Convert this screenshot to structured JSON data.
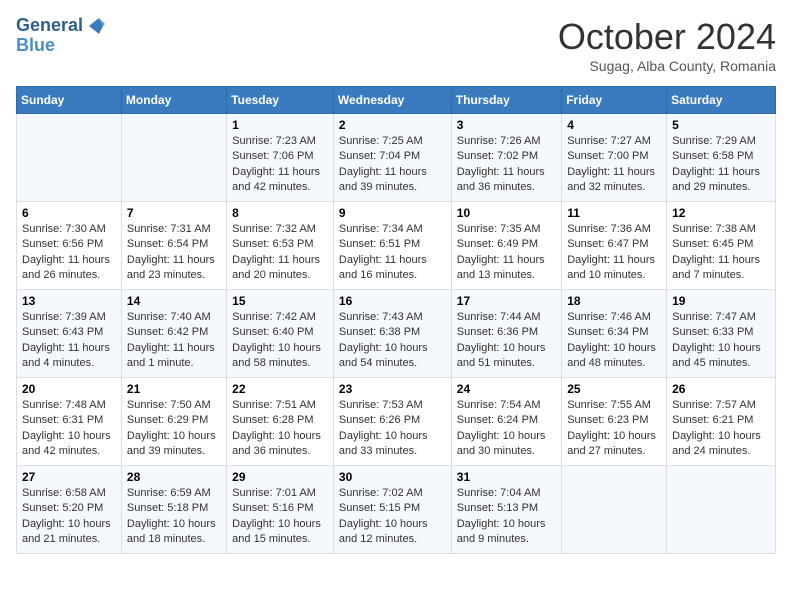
{
  "logo": {
    "line1": "General",
    "line2": "Blue"
  },
  "header": {
    "month": "October 2024",
    "location": "Sugag, Alba County, Romania"
  },
  "weekdays": [
    "Sunday",
    "Monday",
    "Tuesday",
    "Wednesday",
    "Thursday",
    "Friday",
    "Saturday"
  ],
  "weeks": [
    [
      {
        "day": "",
        "info": ""
      },
      {
        "day": "",
        "info": ""
      },
      {
        "day": "1",
        "info": "Sunrise: 7:23 AM\nSunset: 7:06 PM\nDaylight: 11 hours and 42 minutes."
      },
      {
        "day": "2",
        "info": "Sunrise: 7:25 AM\nSunset: 7:04 PM\nDaylight: 11 hours and 39 minutes."
      },
      {
        "day": "3",
        "info": "Sunrise: 7:26 AM\nSunset: 7:02 PM\nDaylight: 11 hours and 36 minutes."
      },
      {
        "day": "4",
        "info": "Sunrise: 7:27 AM\nSunset: 7:00 PM\nDaylight: 11 hours and 32 minutes."
      },
      {
        "day": "5",
        "info": "Sunrise: 7:29 AM\nSunset: 6:58 PM\nDaylight: 11 hours and 29 minutes."
      }
    ],
    [
      {
        "day": "6",
        "info": "Sunrise: 7:30 AM\nSunset: 6:56 PM\nDaylight: 11 hours and 26 minutes."
      },
      {
        "day": "7",
        "info": "Sunrise: 7:31 AM\nSunset: 6:54 PM\nDaylight: 11 hours and 23 minutes."
      },
      {
        "day": "8",
        "info": "Sunrise: 7:32 AM\nSunset: 6:53 PM\nDaylight: 11 hours and 20 minutes."
      },
      {
        "day": "9",
        "info": "Sunrise: 7:34 AM\nSunset: 6:51 PM\nDaylight: 11 hours and 16 minutes."
      },
      {
        "day": "10",
        "info": "Sunrise: 7:35 AM\nSunset: 6:49 PM\nDaylight: 11 hours and 13 minutes."
      },
      {
        "day": "11",
        "info": "Sunrise: 7:36 AM\nSunset: 6:47 PM\nDaylight: 11 hours and 10 minutes."
      },
      {
        "day": "12",
        "info": "Sunrise: 7:38 AM\nSunset: 6:45 PM\nDaylight: 11 hours and 7 minutes."
      }
    ],
    [
      {
        "day": "13",
        "info": "Sunrise: 7:39 AM\nSunset: 6:43 PM\nDaylight: 11 hours and 4 minutes."
      },
      {
        "day": "14",
        "info": "Sunrise: 7:40 AM\nSunset: 6:42 PM\nDaylight: 11 hours and 1 minute."
      },
      {
        "day": "15",
        "info": "Sunrise: 7:42 AM\nSunset: 6:40 PM\nDaylight: 10 hours and 58 minutes."
      },
      {
        "day": "16",
        "info": "Sunrise: 7:43 AM\nSunset: 6:38 PM\nDaylight: 10 hours and 54 minutes."
      },
      {
        "day": "17",
        "info": "Sunrise: 7:44 AM\nSunset: 6:36 PM\nDaylight: 10 hours and 51 minutes."
      },
      {
        "day": "18",
        "info": "Sunrise: 7:46 AM\nSunset: 6:34 PM\nDaylight: 10 hours and 48 minutes."
      },
      {
        "day": "19",
        "info": "Sunrise: 7:47 AM\nSunset: 6:33 PM\nDaylight: 10 hours and 45 minutes."
      }
    ],
    [
      {
        "day": "20",
        "info": "Sunrise: 7:48 AM\nSunset: 6:31 PM\nDaylight: 10 hours and 42 minutes."
      },
      {
        "day": "21",
        "info": "Sunrise: 7:50 AM\nSunset: 6:29 PM\nDaylight: 10 hours and 39 minutes."
      },
      {
        "day": "22",
        "info": "Sunrise: 7:51 AM\nSunset: 6:28 PM\nDaylight: 10 hours and 36 minutes."
      },
      {
        "day": "23",
        "info": "Sunrise: 7:53 AM\nSunset: 6:26 PM\nDaylight: 10 hours and 33 minutes."
      },
      {
        "day": "24",
        "info": "Sunrise: 7:54 AM\nSunset: 6:24 PM\nDaylight: 10 hours and 30 minutes."
      },
      {
        "day": "25",
        "info": "Sunrise: 7:55 AM\nSunset: 6:23 PM\nDaylight: 10 hours and 27 minutes."
      },
      {
        "day": "26",
        "info": "Sunrise: 7:57 AM\nSunset: 6:21 PM\nDaylight: 10 hours and 24 minutes."
      }
    ],
    [
      {
        "day": "27",
        "info": "Sunrise: 6:58 AM\nSunset: 5:20 PM\nDaylight: 10 hours and 21 minutes."
      },
      {
        "day": "28",
        "info": "Sunrise: 6:59 AM\nSunset: 5:18 PM\nDaylight: 10 hours and 18 minutes."
      },
      {
        "day": "29",
        "info": "Sunrise: 7:01 AM\nSunset: 5:16 PM\nDaylight: 10 hours and 15 minutes."
      },
      {
        "day": "30",
        "info": "Sunrise: 7:02 AM\nSunset: 5:15 PM\nDaylight: 10 hours and 12 minutes."
      },
      {
        "day": "31",
        "info": "Sunrise: 7:04 AM\nSunset: 5:13 PM\nDaylight: 10 hours and 9 minutes."
      },
      {
        "day": "",
        "info": ""
      },
      {
        "day": "",
        "info": ""
      }
    ]
  ]
}
